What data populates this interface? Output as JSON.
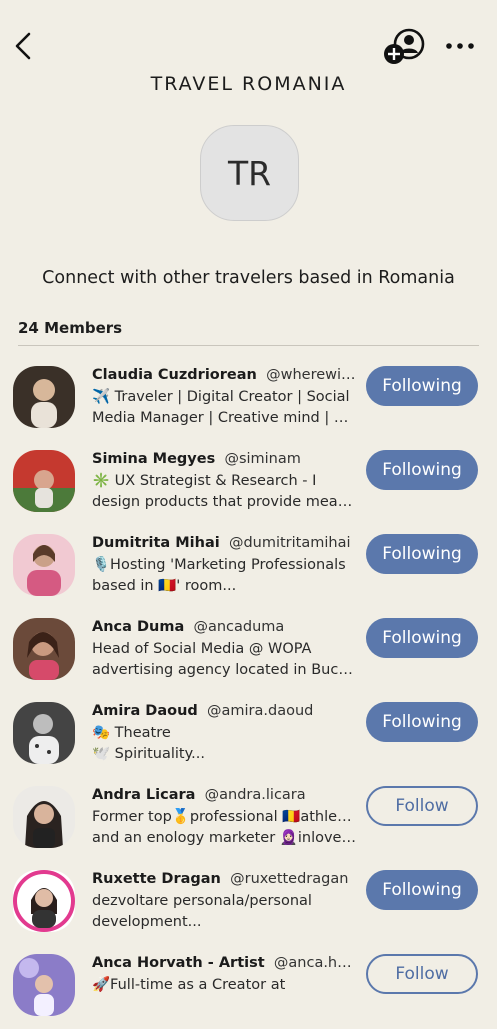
{
  "header": {
    "title": "TRAVEL ROMANIA",
    "avatar_initials": "TR",
    "description": "Connect with other travelers based in Romania",
    "members_count": "24 Members"
  },
  "members": [
    {
      "name": "Claudia Cuzdriorean",
      "handle": "@wherewinds",
      "bio1": "✈️ Traveler | Digital Creator | Social",
      "bio2": "Media Manager | Creative mind | Vi...",
      "button": "Following",
      "state": "following",
      "avatar_color": "#3a3028"
    },
    {
      "name": "Simina Megyes",
      "handle": "@siminam",
      "bio1": "✳️ UX Strategist & Research - I",
      "bio2": "design products that provide meani...",
      "button": "Following",
      "state": "following",
      "avatar_color": "#c5392f"
    },
    {
      "name": "Dumitrita Mihai",
      "handle": "@dumitritamihai",
      "bio1": "🎙️Hosting 'Marketing Professionals",
      "bio2": "based in 🇷🇴' room...",
      "button": "Following",
      "state": "following",
      "avatar_color": "#e5a9b8"
    },
    {
      "name": "Anca Duma",
      "handle": "@ancaduma",
      "bio1": "Head of Social Media @ WOPA",
      "bio2": "advertising agency located in Buch...",
      "button": "Following",
      "state": "following",
      "avatar_color": "#6b4a3a"
    },
    {
      "name": "Amira Daoud",
      "handle": "@amira.daoud",
      "bio1": "🎭 Theatre",
      "bio2": "🕊️ Spirituality...",
      "button": "Following",
      "state": "following",
      "avatar_color": "#555555"
    },
    {
      "name": "Andra Licara",
      "handle": "@andra.licara",
      "bio1": "Former top🥇professional 🇷🇴athlete,",
      "bio2": "and an enology marketer 🧕🏻inloved...",
      "button": "Follow",
      "state": "follow",
      "avatar_color": "#2a2320"
    },
    {
      "name": "Ruxette Dragan",
      "handle": "@ruxettedragan",
      "bio1": "dezvoltare personala/personal",
      "bio2": "development...",
      "button": "Following",
      "state": "following",
      "avatar_color": "#e23a8f"
    },
    {
      "name": "Anca Horvath - Artist",
      "handle": "@anca.horva...",
      "bio1": "🚀Full-time as a Creator at",
      "bio2": "",
      "button": "Follow",
      "state": "follow",
      "avatar_color": "#8b7cc8"
    }
  ]
}
